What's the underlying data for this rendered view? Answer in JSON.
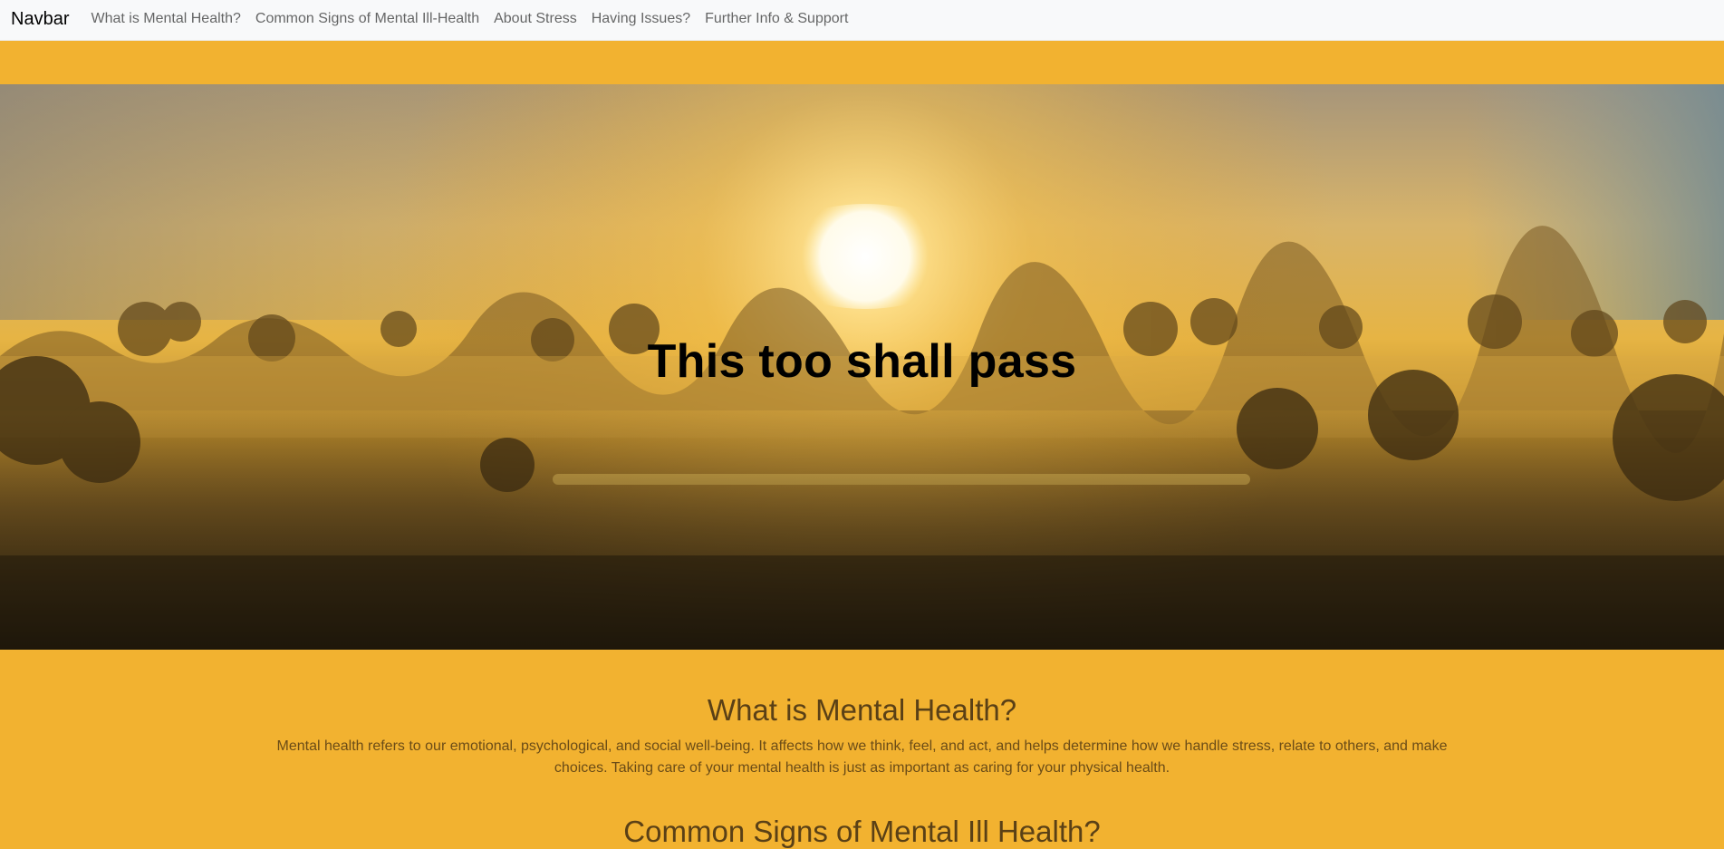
{
  "navbar": {
    "brand": "Navbar",
    "links": [
      "What is Mental Health?",
      "Common Signs of Mental Ill-Health",
      "About Stress",
      "Having Issues?",
      "Further Info & Support"
    ]
  },
  "hero": {
    "title": "This too shall pass"
  },
  "sections": [
    {
      "heading": "What is Mental Health?",
      "text": "Mental health refers to our emotional, psychological, and social well-being. It affects how we think, feel, and act, and helps determine how we handle stress, relate to others, and make choices. Taking care of your mental health is just as important as caring for your physical health."
    },
    {
      "heading": "Common Signs of Mental Ill Health?"
    }
  ],
  "colors": {
    "accent": "#f2b230",
    "navbar_bg": "#f8f9fa",
    "heading": "#5a4016"
  }
}
